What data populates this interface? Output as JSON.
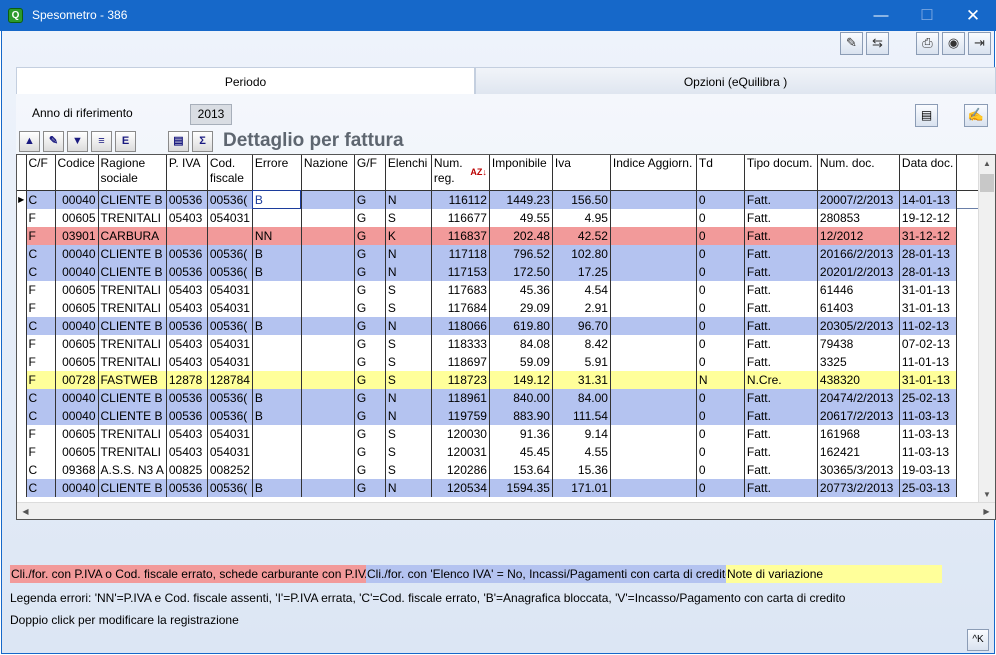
{
  "window": {
    "title": "Spesometro - 386",
    "app_icon": "Q",
    "min": "—",
    "max": "☐",
    "close": "✕"
  },
  "toolbar": {
    "wand_icon": "✎",
    "refresh_icon": "⇆",
    "print_icon": "⎙",
    "web_icon": "◉",
    "exit_icon": "⇥"
  },
  "tabs": [
    {
      "label": "Periodo"
    },
    {
      "label": "Opzioni (eQuilibra )"
    }
  ],
  "period": {
    "year_label": "Anno di riferimento",
    "year_value": "2013",
    "doc_icon": "▤",
    "sign_icon": "✍"
  },
  "grid": {
    "title": "Dettaglio per fattura",
    "tools": {
      "up": "▲",
      "edit": "✎",
      "filter": "▼",
      "list": "≡",
      "excel": "E",
      "detail": "▤",
      "sigma": "Σ"
    },
    "headers": [
      "C/F",
      "Codice",
      "Ragione sociale",
      "P. IVA",
      "Cod. fiscale",
      "Errore",
      "Nazione",
      "G/F",
      "Elenchi",
      "Num. reg.",
      "Imponibile",
      "Iva",
      "Indice Aggiorn.",
      "Td",
      "Tipo docum.",
      "Num. doc.",
      "Data doc."
    ],
    "sort_icon": "AZ↓",
    "rows": [
      {
        "style": "blue",
        "cf": "C",
        "codice": "00040",
        "ragione": "CLIENTE B",
        "piva": "00536",
        "codfisc": "00536(",
        "errore": "B",
        "nazione": "",
        "gf": "G",
        "elenchi": "N",
        "numreg": "116112",
        "imponibile": "1449.23",
        "iva": "156.50",
        "indice": "",
        "td": "0",
        "tipo": "Fatt.",
        "numdoc": "20007/2/2013",
        "data": "14-01-13"
      },
      {
        "style": "white",
        "cf": "F",
        "codice": "00605",
        "ragione": "TRENITALI",
        "piva": "05403",
        "codfisc": "054031",
        "errore": "",
        "nazione": "",
        "gf": "G",
        "elenchi": "S",
        "numreg": "116677",
        "imponibile": "49.55",
        "iva": "4.95",
        "indice": "",
        "td": "0",
        "tipo": "Fatt.",
        "numdoc": "280853",
        "data": "19-12-12"
      },
      {
        "style": "red",
        "cf": "F",
        "codice": "03901",
        "ragione": "CARBURA",
        "piva": "",
        "codfisc": "",
        "errore": "NN",
        "nazione": "",
        "gf": "G",
        "elenchi": "K",
        "numreg": "116837",
        "imponibile": "202.48",
        "iva": "42.52",
        "indice": "",
        "td": "0",
        "tipo": "Fatt.",
        "numdoc": "12/2012",
        "data": "31-12-12"
      },
      {
        "style": "blue",
        "cf": "C",
        "codice": "00040",
        "ragione": "CLIENTE B",
        "piva": "00536",
        "codfisc": "00536(",
        "errore": "B",
        "nazione": "",
        "gf": "G",
        "elenchi": "N",
        "numreg": "117118",
        "imponibile": "796.52",
        "iva": "102.80",
        "indice": "",
        "td": "0",
        "tipo": "Fatt.",
        "numdoc": "20166/2/2013",
        "data": "28-01-13"
      },
      {
        "style": "blue",
        "cf": "C",
        "codice": "00040",
        "ragione": "CLIENTE B",
        "piva": "00536",
        "codfisc": "00536(",
        "errore": "B",
        "nazione": "",
        "gf": "G",
        "elenchi": "N",
        "numreg": "117153",
        "imponibile": "172.50",
        "iva": "17.25",
        "indice": "",
        "td": "0",
        "tipo": "Fatt.",
        "numdoc": "20201/2/2013",
        "data": "28-01-13"
      },
      {
        "style": "white",
        "cf": "F",
        "codice": "00605",
        "ragione": "TRENITALI",
        "piva": "05403",
        "codfisc": "054031",
        "errore": "",
        "nazione": "",
        "gf": "G",
        "elenchi": "S",
        "numreg": "117683",
        "imponibile": "45.36",
        "iva": "4.54",
        "indice": "",
        "td": "0",
        "tipo": "Fatt.",
        "numdoc": "61446",
        "data": "31-01-13"
      },
      {
        "style": "white",
        "cf": "F",
        "codice": "00605",
        "ragione": "TRENITALI",
        "piva": "05403",
        "codfisc": "054031",
        "errore": "",
        "nazione": "",
        "gf": "G",
        "elenchi": "S",
        "numreg": "117684",
        "imponibile": "29.09",
        "iva": "2.91",
        "indice": "",
        "td": "0",
        "tipo": "Fatt.",
        "numdoc": "61403",
        "data": "31-01-13"
      },
      {
        "style": "blue",
        "cf": "C",
        "codice": "00040",
        "ragione": "CLIENTE B",
        "piva": "00536",
        "codfisc": "00536(",
        "errore": "B",
        "nazione": "",
        "gf": "G",
        "elenchi": "N",
        "numreg": "118066",
        "imponibile": "619.80",
        "iva": "96.70",
        "indice": "",
        "td": "0",
        "tipo": "Fatt.",
        "numdoc": "20305/2/2013",
        "data": "11-02-13"
      },
      {
        "style": "white",
        "cf": "F",
        "codice": "00605",
        "ragione": "TRENITALI",
        "piva": "05403",
        "codfisc": "054031",
        "errore": "",
        "nazione": "",
        "gf": "G",
        "elenchi": "S",
        "numreg": "118333",
        "imponibile": "84.08",
        "iva": "8.42",
        "indice": "",
        "td": "0",
        "tipo": "Fatt.",
        "numdoc": "79438",
        "data": "07-02-13"
      },
      {
        "style": "white",
        "cf": "F",
        "codice": "00605",
        "ragione": "TRENITALI",
        "piva": "05403",
        "codfisc": "054031",
        "errore": "",
        "nazione": "",
        "gf": "G",
        "elenchi": "S",
        "numreg": "118697",
        "imponibile": "59.09",
        "iva": "5.91",
        "indice": "",
        "td": "0",
        "tipo": "Fatt.",
        "numdoc": "3325",
        "data": "11-01-13"
      },
      {
        "style": "yellow",
        "cf": "F",
        "codice": "00728",
        "ragione": "FASTWEB",
        "piva": "12878",
        "codfisc": "128784",
        "errore": "",
        "nazione": "",
        "gf": "G",
        "elenchi": "S",
        "numreg": "118723",
        "imponibile": "149.12",
        "iva": "31.31",
        "indice": "",
        "td": "N",
        "tipo": "N.Cre.",
        "numdoc": "438320",
        "data": "31-01-13"
      },
      {
        "style": "blue",
        "cf": "C",
        "codice": "00040",
        "ragione": "CLIENTE B",
        "piva": "00536",
        "codfisc": "00536(",
        "errore": "B",
        "nazione": "",
        "gf": "G",
        "elenchi": "N",
        "numreg": "118961",
        "imponibile": "840.00",
        "iva": "84.00",
        "indice": "",
        "td": "0",
        "tipo": "Fatt.",
        "numdoc": "20474/2/2013",
        "data": "25-02-13"
      },
      {
        "style": "blue",
        "cf": "C",
        "codice": "00040",
        "ragione": "CLIENTE B",
        "piva": "00536",
        "codfisc": "00536(",
        "errore": "B",
        "nazione": "",
        "gf": "G",
        "elenchi": "N",
        "numreg": "119759",
        "imponibile": "883.90",
        "iva": "111.54",
        "indice": "",
        "td": "0",
        "tipo": "Fatt.",
        "numdoc": "20617/2/2013",
        "data": "11-03-13"
      },
      {
        "style": "white",
        "cf": "F",
        "codice": "00605",
        "ragione": "TRENITALI",
        "piva": "05403",
        "codfisc": "054031",
        "errore": "",
        "nazione": "",
        "gf": "G",
        "elenchi": "S",
        "numreg": "120030",
        "imponibile": "91.36",
        "iva": "9.14",
        "indice": "",
        "td": "0",
        "tipo": "Fatt.",
        "numdoc": "161968",
        "data": "11-03-13"
      },
      {
        "style": "white",
        "cf": "F",
        "codice": "00605",
        "ragione": "TRENITALI",
        "piva": "05403",
        "codfisc": "054031",
        "errore": "",
        "nazione": "",
        "gf": "G",
        "elenchi": "S",
        "numreg": "120031",
        "imponibile": "45.45",
        "iva": "4.55",
        "indice": "",
        "td": "0",
        "tipo": "Fatt.",
        "numdoc": "162421",
        "data": "11-03-13"
      },
      {
        "style": "white",
        "cf": "C",
        "codice": "09368",
        "ragione": "A.S.S. N3 A",
        "piva": "00825",
        "codfisc": "008252",
        "errore": "",
        "nazione": "",
        "gf": "G",
        "elenchi": "S",
        "numreg": "120286",
        "imponibile": "153.64",
        "iva": "15.36",
        "indice": "",
        "td": "0",
        "tipo": "Fatt.",
        "numdoc": "30365/3/2013",
        "data": "19-03-13"
      },
      {
        "style": "blue",
        "cf": "C",
        "codice": "00040",
        "ragione": "CLIENTE B",
        "piva": "00536",
        "codfisc": "00536(",
        "errore": "B",
        "nazione": "",
        "gf": "G",
        "elenchi": "N",
        "numreg": "120534",
        "imponibile": "1594.35",
        "iva": "171.01",
        "indice": "",
        "td": "0",
        "tipo": "Fatt.",
        "numdoc": "20773/2/2013",
        "data": "25-03-13"
      }
    ],
    "scroll": {
      "up": "▲",
      "down": "▼",
      "left": "◀",
      "right": "▶"
    }
  },
  "legend": {
    "red": "Cli./for. con P.IVA o Cod. fiscale errato, schede carburante con P.IVA",
    "blue": "Cli./for. con 'Elenco IVA' = No, Incassi/Pagamenti con carta di credito",
    "yellow": "Note di variazione"
  },
  "notes": {
    "errors": "Legenda errori: 'NN'=P.IVA e Cod. fiscale assenti, 'I'=P.IVA errata, 'C'=Cod. fiscale errato, 'B'=Anagrafica bloccata, 'V'=Incasso/Pagamento con carta di credito",
    "dblclick": "Doppio click per modificare la registrazione"
  },
  "kbutton": "^K"
}
